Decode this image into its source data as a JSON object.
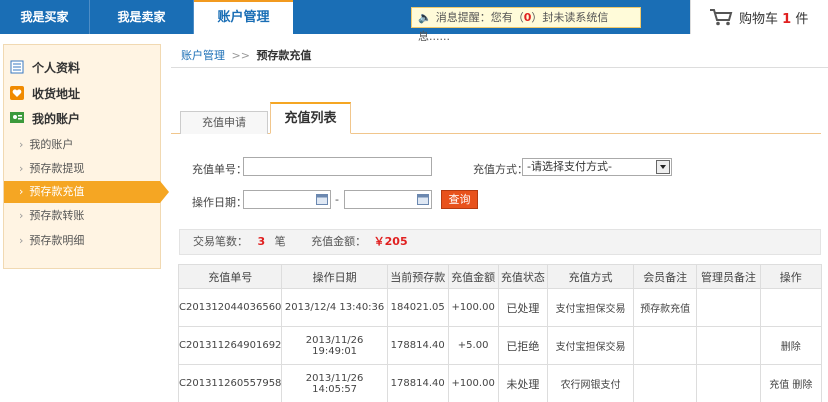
{
  "nav": {
    "tabs": [
      {
        "label": "我是买家"
      },
      {
        "label": "我是卖家"
      },
      {
        "label": "账户管理"
      }
    ],
    "notice": {
      "prefix": "消息提醒：您有（",
      "count": "0",
      "suffix": "）封未读系统信息......"
    },
    "cart": {
      "label": "购物车",
      "count": "1",
      "unit": "件"
    }
  },
  "sidebar": {
    "main_items": [
      {
        "label": "个人资料",
        "icon": "profile-icon"
      },
      {
        "label": "收货地址",
        "icon": "heart-icon"
      },
      {
        "label": "我的账户",
        "icon": "account-icon"
      }
    ],
    "sub_items": [
      {
        "label": "我的账户"
      },
      {
        "label": "预存款提现"
      },
      {
        "label": "预存款充值"
      },
      {
        "label": "预存款转账"
      },
      {
        "label": "预存款明细"
      }
    ]
  },
  "breadcrumb": {
    "root": "账户管理",
    "separator": ">>",
    "current": "预存款充值"
  },
  "tabs": [
    {
      "label": "充值申请"
    },
    {
      "label": "充值列表"
    }
  ],
  "filter": {
    "order_label": "充值单号：",
    "order_value": "",
    "method_label": "充值方式：",
    "method_value": "-请选择支付方式-",
    "date_label": "操作日期：",
    "date_sep": "-",
    "query_button": "查询"
  },
  "summary": {
    "count_label": "交易笔数：",
    "count_value": "3",
    "count_unit": "笔",
    "amount_label": "充值金额：",
    "amount_value": "￥205"
  },
  "table": {
    "headers": [
      "充值单号",
      "操作日期",
      "当前预存款",
      "充值金额",
      "充值状态",
      "充值方式",
      "会员备注",
      "管理员备注",
      "操作"
    ],
    "rows": [
      [
        "C201312044036560",
        "2013/12/4 13:40:36",
        "184021.05",
        "+100.00",
        "已处理",
        "支付宝担保交易",
        "预存款充值",
        "",
        ""
      ],
      [
        "C201311264901692",
        "2013/11/26 19:49:01",
        "178814.40",
        "+5.00",
        "已拒绝",
        "支付宝担保交易",
        "",
        "",
        "删除"
      ],
      [
        "C201311260557958",
        "2013/11/26 14:05:57",
        "178814.40",
        "+100.00",
        "未处理",
        "农行网银支付",
        "",
        "",
        "充值 删除"
      ]
    ]
  },
  "colors": {
    "nav_blue": "#1a6eb5",
    "accent_orange": "#f5a623",
    "query_red": "#e8521c",
    "amount_red": "#d42020"
  }
}
